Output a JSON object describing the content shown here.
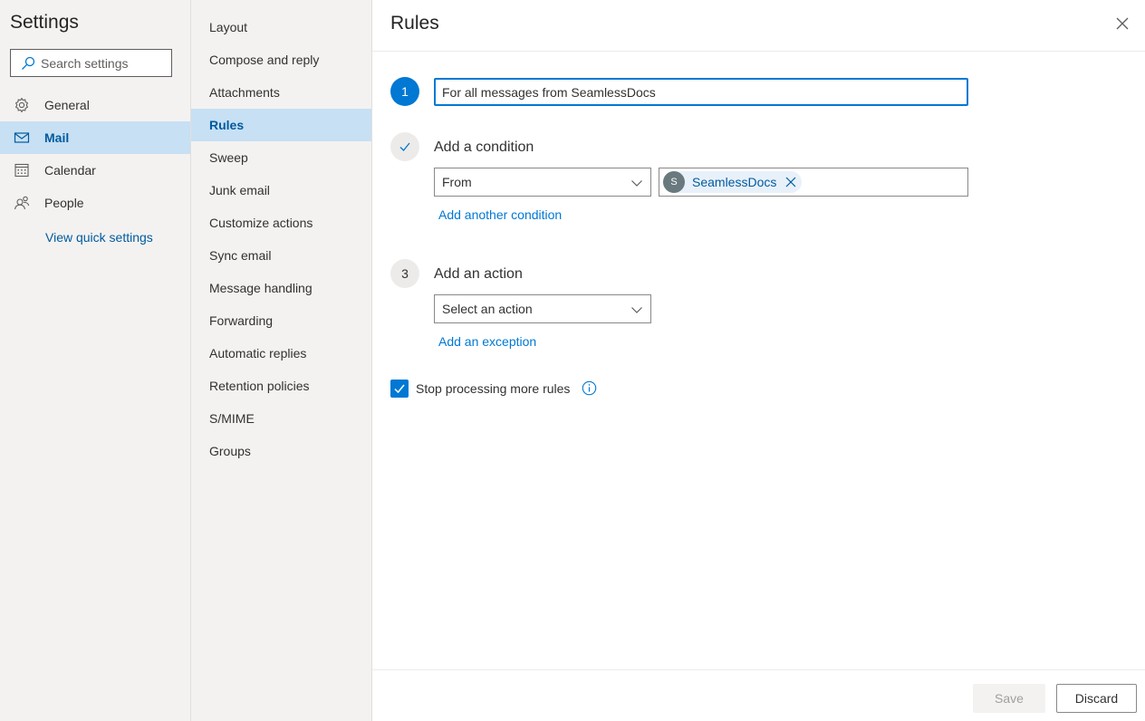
{
  "settings": {
    "title": "Settings",
    "search_placeholder": "Search settings",
    "categories": [
      {
        "label": "General",
        "icon": "gear-icon"
      },
      {
        "label": "Mail",
        "icon": "mail-icon"
      },
      {
        "label": "Calendar",
        "icon": "calendar-icon"
      },
      {
        "label": "People",
        "icon": "people-icon"
      }
    ],
    "active_category": "Mail",
    "quick_settings_link": "View quick settings"
  },
  "mail_nav": {
    "items": [
      "Layout",
      "Compose and reply",
      "Attachments",
      "Rules",
      "Sweep",
      "Junk email",
      "Customize actions",
      "Sync email",
      "Message handling",
      "Forwarding",
      "Automatic replies",
      "Retention policies",
      "S/MIME",
      "Groups"
    ],
    "active_item": "Rules"
  },
  "rule_editor": {
    "title": "Rules",
    "step1": {
      "number": "1",
      "rule_name_value": "For all messages from SeamlessDocs"
    },
    "step2": {
      "status": "complete",
      "heading": "Add a condition",
      "condition_selected": "From",
      "recipient": {
        "initial": "S",
        "name": "SeamlessDocs"
      },
      "add_condition_link": "Add another condition"
    },
    "step3": {
      "number": "3",
      "heading": "Add an action",
      "action_placeholder": "Select an action",
      "add_exception_link": "Add an exception"
    },
    "stop_processing": {
      "checked": true,
      "label": "Stop processing more rules"
    },
    "footer": {
      "save_label": "Save",
      "save_disabled": true,
      "discard_label": "Discard"
    }
  },
  "colors": {
    "accent": "#0078d4",
    "active_nav": "#c7e0f4",
    "link": "#005a9e",
    "nav_bg": "#f3f2f1"
  }
}
